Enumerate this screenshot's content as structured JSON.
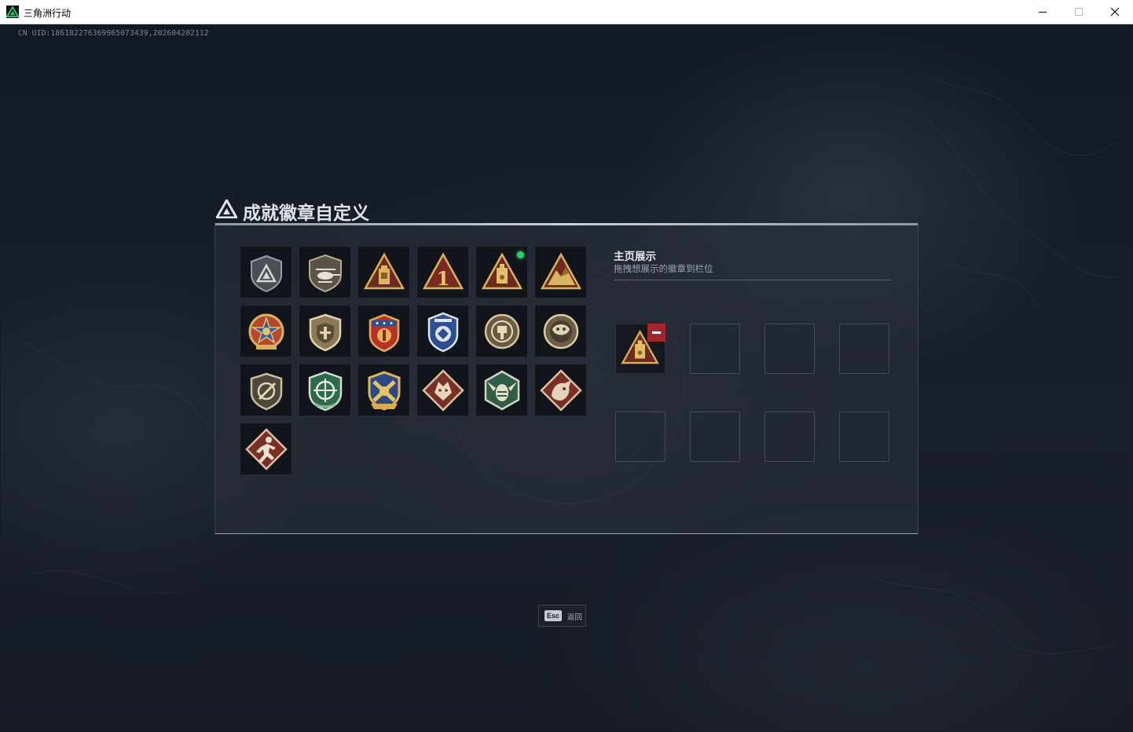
{
  "window": {
    "title": "三角洲行动"
  },
  "uid": "CN UID:186182276369965073439,202604202112",
  "dialog": {
    "title": "成就徽章自定义"
  },
  "colors": {
    "accent_green": "#27d36b",
    "remove_red": "#a4262c",
    "badge_gold": "#c9a04a",
    "badge_red": "#8a2f28"
  },
  "badges": [
    {
      "icon": "shield-triangle-badge-icon",
      "new": false
    },
    {
      "icon": "helicopter-shield-badge-icon",
      "new": false
    },
    {
      "icon": "triangle-tower-badge-icon",
      "new": false
    },
    {
      "icon": "triangle-number-one-badge-icon",
      "new": false
    },
    {
      "icon": "triangle-mp3-badge-icon",
      "new": true
    },
    {
      "icon": "triangle-mountain-badge-icon",
      "new": false
    },
    {
      "icon": "star-medal-badge-icon",
      "new": false
    },
    {
      "icon": "shield-emblem-badge-icon",
      "new": false
    },
    {
      "icon": "red-crest-badge-icon",
      "new": false
    },
    {
      "icon": "blue-shield-badge-icon",
      "new": false
    },
    {
      "icon": "round-target-badge-icon",
      "new": false
    },
    {
      "icon": "round-beast-badge-icon",
      "new": false
    },
    {
      "icon": "shield-slash-badge-icon",
      "new": false
    },
    {
      "icon": "green-crosshair-badge-icon",
      "new": false
    },
    {
      "icon": "gold-crossed-badge-icon",
      "new": false
    },
    {
      "icon": "diamond-wolf-badge-icon",
      "new": false
    },
    {
      "icon": "hexagon-hornet-badge-icon",
      "new": false
    },
    {
      "icon": "diamond-dragon-badge-icon",
      "new": false
    },
    {
      "icon": "diamond-runner-badge-icon",
      "new": false
    }
  ],
  "showcase": {
    "title": "主页展示",
    "subtitle": "拖拽想展示的徽章到栏位",
    "slots": [
      {
        "badge": "triangle-mp3-badge-icon"
      },
      {
        "badge": null
      },
      {
        "badge": null
      },
      {
        "badge": null
      },
      {
        "badge": null
      },
      {
        "badge": null
      },
      {
        "badge": null
      },
      {
        "badge": null
      }
    ]
  },
  "footer": {
    "esc_key": "Esc",
    "esc_label": "返回"
  }
}
